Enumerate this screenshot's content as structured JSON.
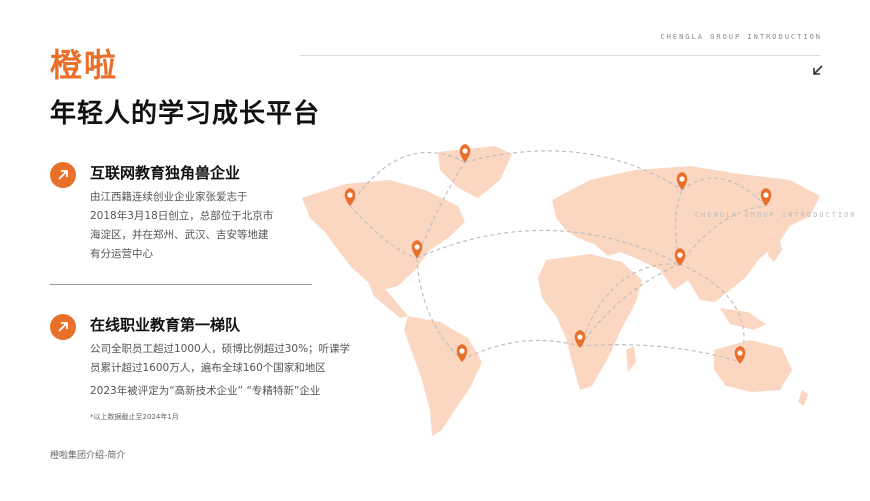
{
  "header": {
    "brand": "橙啦",
    "subtitle": "年轻人的学习成长平台",
    "tag": "CHENGLA GROUP INTRODUCTION"
  },
  "section1": {
    "title": "互联网教育独角兽企业",
    "lines": [
      "由江西籍连续创业企业家张爱志于",
      "2018年3月18日创立，总部位于北京市",
      "海淀区，并在郑州、武汉、吉安等地建",
      "有分运营中心"
    ]
  },
  "section2": {
    "title": "在线职业教育第一梯队",
    "lines": [
      "公司全职员工超过1000人，硕博比例超过30%；听课学",
      "员累计超过1600万人，遍布全球160个国家和地区"
    ],
    "extra": "2023年被评定为“高新技术企业” “专精特新”企业",
    "note": "*以上数据截止至2024年1月"
  },
  "footer": {
    "text": "橙啦集团介绍-简介"
  },
  "map": {
    "tag": "CHENGLA GROUP INTRODUCTION"
  },
  "colors": {
    "accent": "#e8702a",
    "land": "#fbd7c2",
    "route": "#bfbfbf"
  },
  "icons": {
    "badge": "arrow-up-right-icon",
    "corner": "arrow-down-left-icon",
    "pin": "map-pin-icon"
  }
}
